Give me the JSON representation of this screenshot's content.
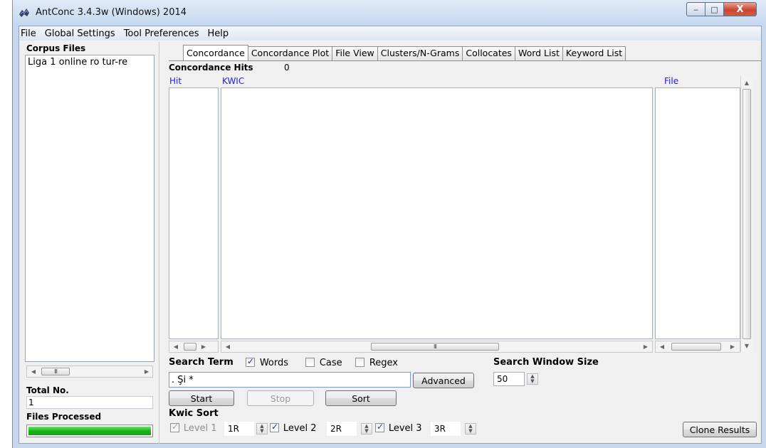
{
  "window": {
    "title": "AntConc 3.4.3w (Windows) 2014",
    "minimize": "‒",
    "maximize": "□",
    "close": "X"
  },
  "menu": [
    "File",
    "Global Settings",
    "Tool Preferences",
    "Help"
  ],
  "left": {
    "corpus_files_label": "Corpus Files",
    "files": [
      "Liga 1 online ro tur-re"
    ],
    "total_no_label": "Total No.",
    "total_no_value": "1",
    "files_processed_label": "Files Processed",
    "progress": 1.0
  },
  "tabs": [
    "Concordance",
    "Concordance Plot",
    "File View",
    "Clusters/N-Grams",
    "Collocates",
    "Word List",
    "Keyword List"
  ],
  "active_tab": 0,
  "concordance": {
    "hits_label": "Concordance Hits",
    "hits_value": "0",
    "col_hit": "Hit",
    "col_kwic": "KWIC",
    "col_file": "File"
  },
  "search": {
    "term_label": "Search Term",
    "words_label": "Words",
    "words_checked": true,
    "case_label": "Case",
    "case_checked": false,
    "regex_label": "Regex",
    "regex_checked": false,
    "term_value": ". Şi *",
    "advanced_label": "Advanced",
    "window_size_label": "Search Window Size",
    "window_size_value": "50"
  },
  "buttons": {
    "start": "Start",
    "stop": "Stop",
    "sort": "Sort",
    "clone_results": "Clone Results"
  },
  "kwic_sort": {
    "label": "Kwic Sort",
    "level1_label": "Level 1",
    "level1_value": "1R",
    "level2_label": "Level 2",
    "level2_value": "2R",
    "level3_label": "Level 3",
    "level3_value": "3R"
  }
}
